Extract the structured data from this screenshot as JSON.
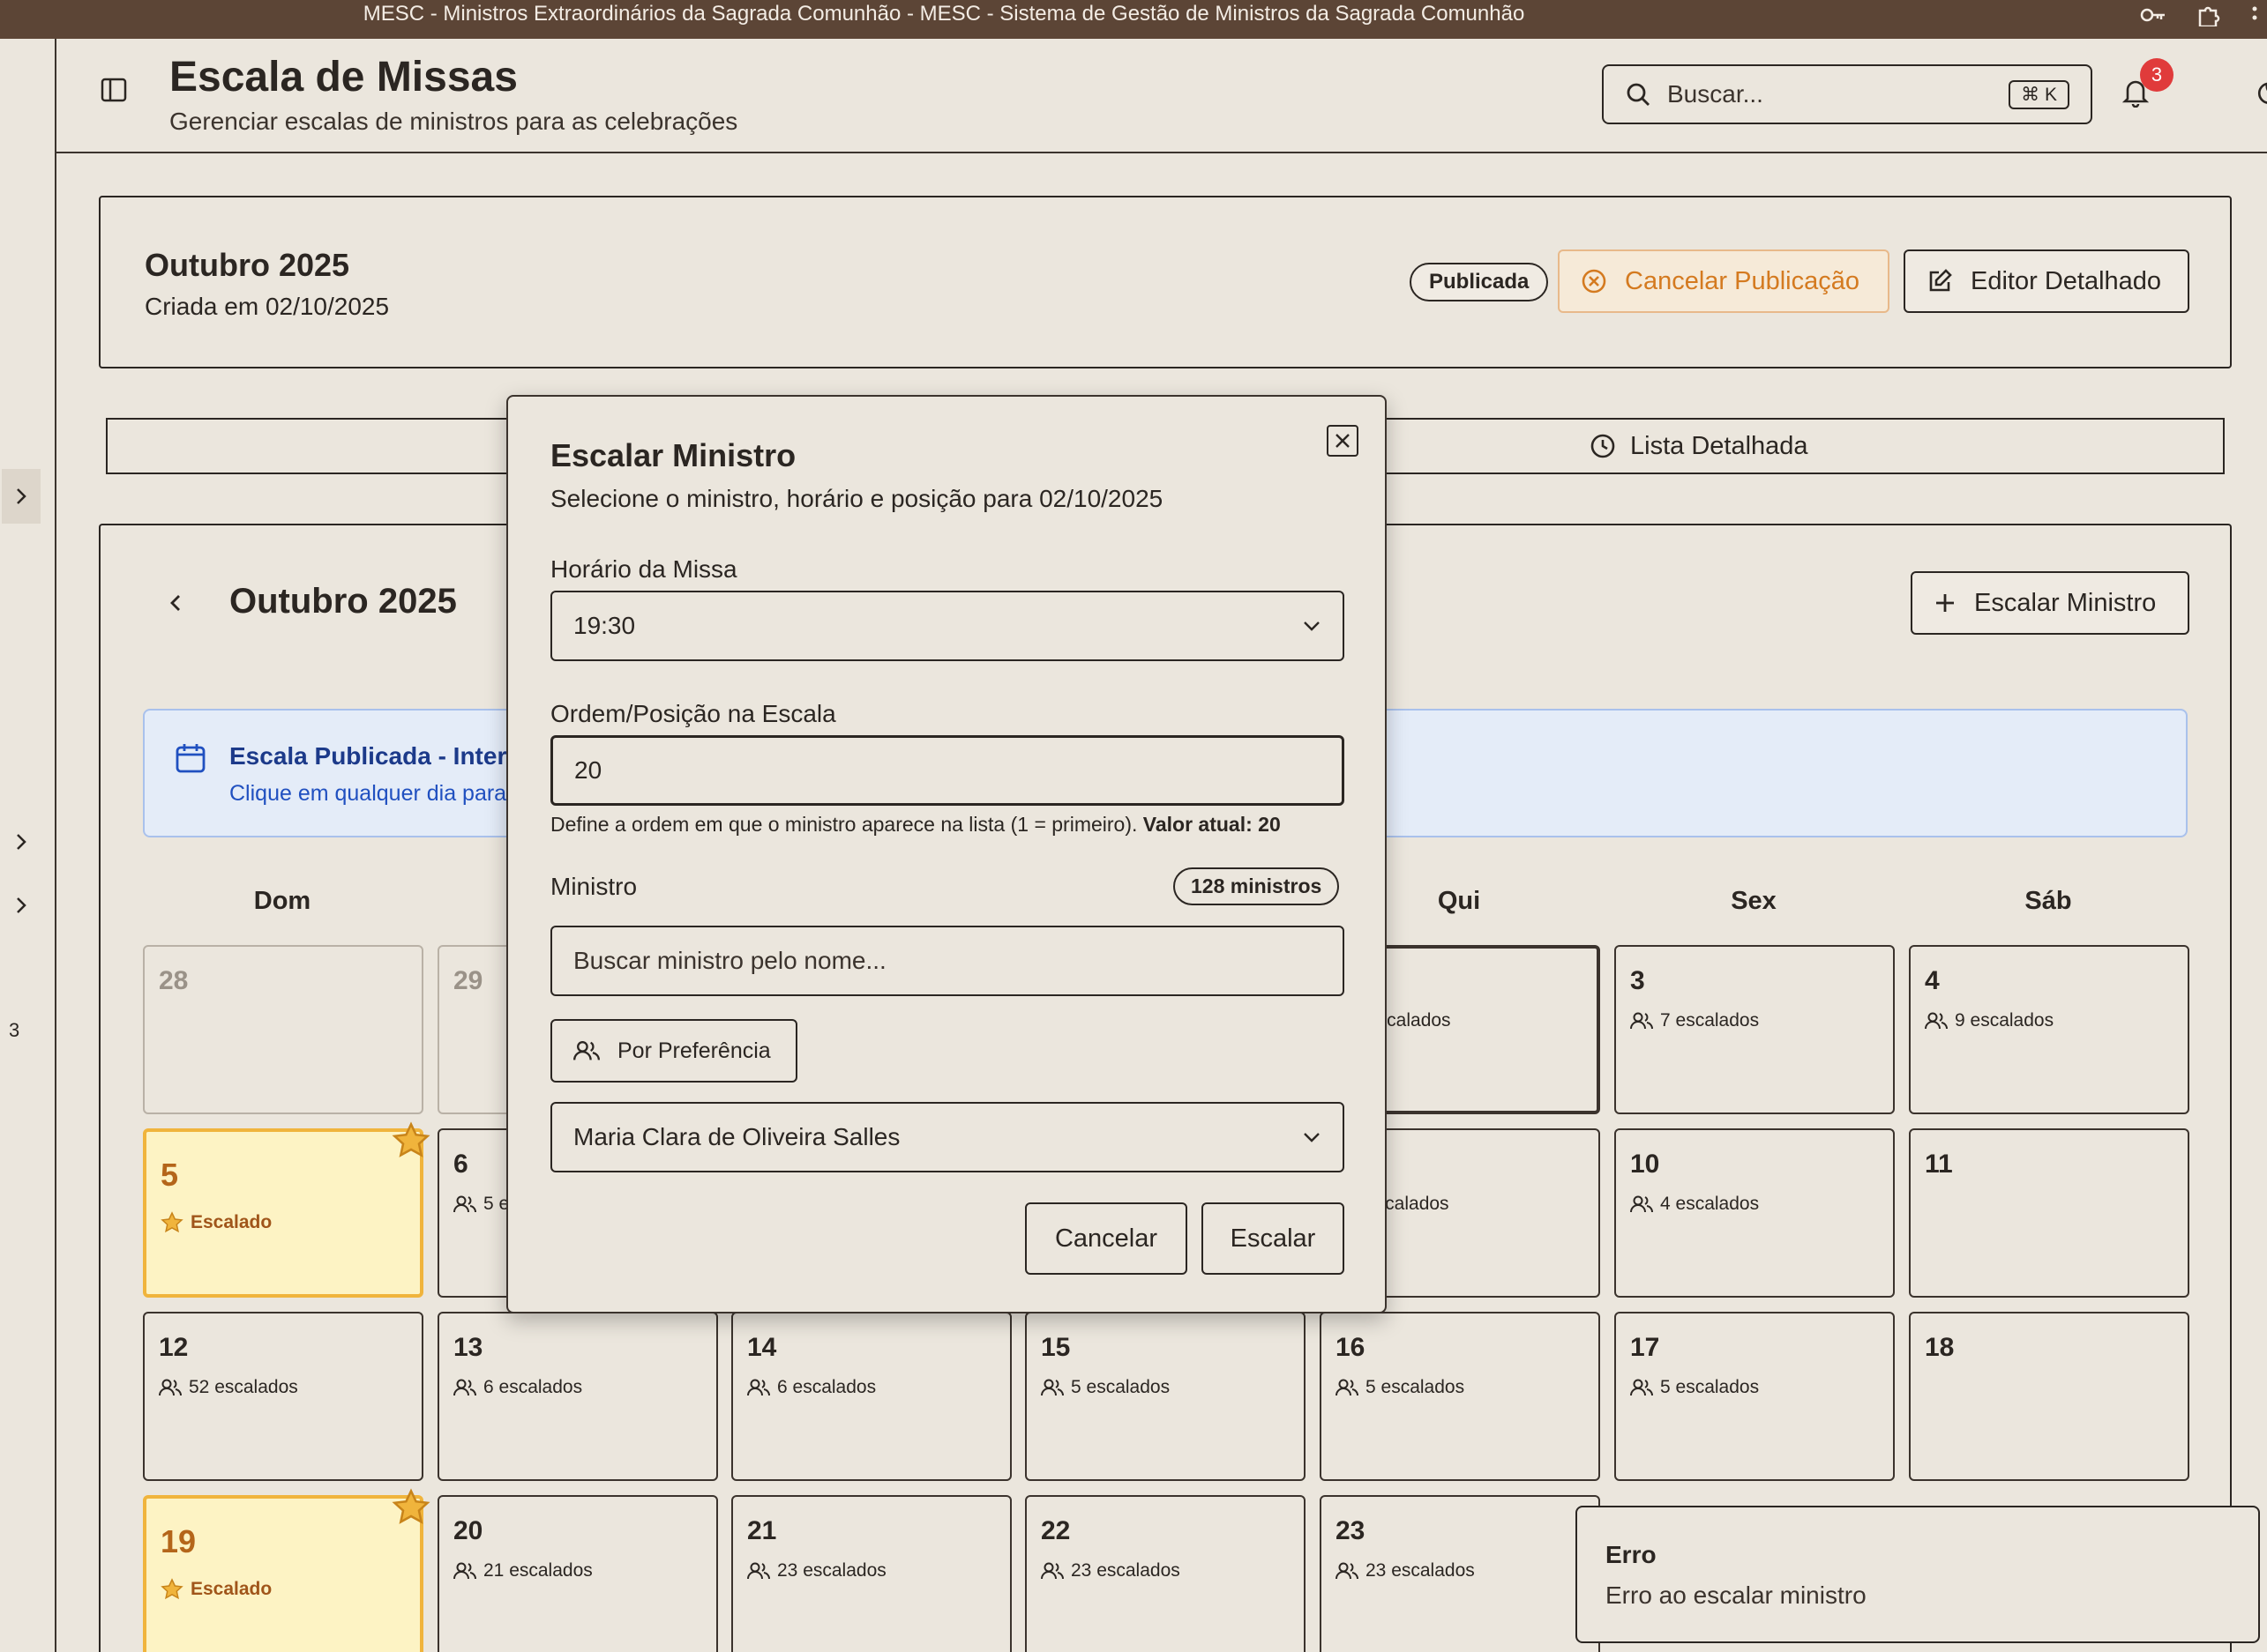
{
  "browser": {
    "title": "MESC - Ministros Extraordinários da Sagrada Comunhão - MESC - Sistema de Gestão de Ministros da Sagrada Comunhão"
  },
  "sidebar": {
    "item_count": "3"
  },
  "header": {
    "title": "Escala de Missas",
    "subtitle": "Gerenciar escalas de ministros para as celebrações",
    "search_placeholder": "Buscar...",
    "search_shortcut": "⌘ K",
    "notifications_count": "3"
  },
  "schedule": {
    "title": "Outubro 2025",
    "created": "Criada em 02/10/2025",
    "status_badge": "Publicada",
    "cancel_publish_label": "Cancelar Publicação",
    "editor_label": "Editor Detalhado"
  },
  "tabs": {
    "detailed_list": "Lista Detalhada"
  },
  "calendar": {
    "month_label": "Outubro 2025",
    "escalar_label": "Escalar Ministro",
    "banner_title": "Escala Publicada - Intera",
    "banner_text": "Clique em qualquer dia para",
    "weekdays": [
      "Dom",
      "",
      "",
      "",
      "Qui",
      "Sex",
      "Sáb"
    ],
    "days": {
      "d28": "28",
      "d29": "29",
      "d2": "escalados",
      "d3": "3",
      "d3c": "7 escalados",
      "d4": "4",
      "d4c": "9 escalados",
      "d5": "5",
      "d5c": "Escalado",
      "d6": "6",
      "d6c": "5 e",
      "d9c": "escalados",
      "d10": "10",
      "d10c": "4 escalados",
      "d11": "11",
      "d12": "12",
      "d12c": "52 escalados",
      "d13": "13",
      "d13c": "6 escalados",
      "d14": "14",
      "d14c": "6 escalados",
      "d15": "15",
      "d15c": "5 escalados",
      "d16": "16",
      "d16c": "5 escalados",
      "d17": "17",
      "d17c": "5 escalados",
      "d18": "18",
      "d19": "19",
      "d19c": "Escalado",
      "d20": "20",
      "d20c": "21 escalados",
      "d21": "21",
      "d21c": "23 escalados",
      "d22": "22",
      "d22c": "23 escalados",
      "d23": "23",
      "d23c": "23 escalados"
    }
  },
  "modal": {
    "title": "Escalar Ministro",
    "description": "Selecione o ministro, horário e posição para 02/10/2025",
    "time_label": "Horário da Missa",
    "time_value": "19:30",
    "order_label": "Ordem/Posição na Escala",
    "order_value": "20",
    "order_hint": "Define a ordem em que o ministro aparece na lista (1 = primeiro).",
    "order_hint_current": "Valor atual: 20",
    "minister_label": "Ministro",
    "minister_count": "128 ministros",
    "minister_search_placeholder": "Buscar ministro pelo nome...",
    "preference_label": "Por Preferência",
    "minister_selected": "Maria Clara de Oliveira Salles",
    "cancel_label": "Cancelar",
    "submit_label": "Escalar"
  },
  "toast": {
    "title": "Erro",
    "message": "Erro ao escalar ministro"
  },
  "colors": {
    "accent_orange": "#d47a20",
    "highlight_yellow": "#fdf3c4",
    "badge_red": "#e03b3b",
    "info_blue": "#1c3a8a"
  }
}
